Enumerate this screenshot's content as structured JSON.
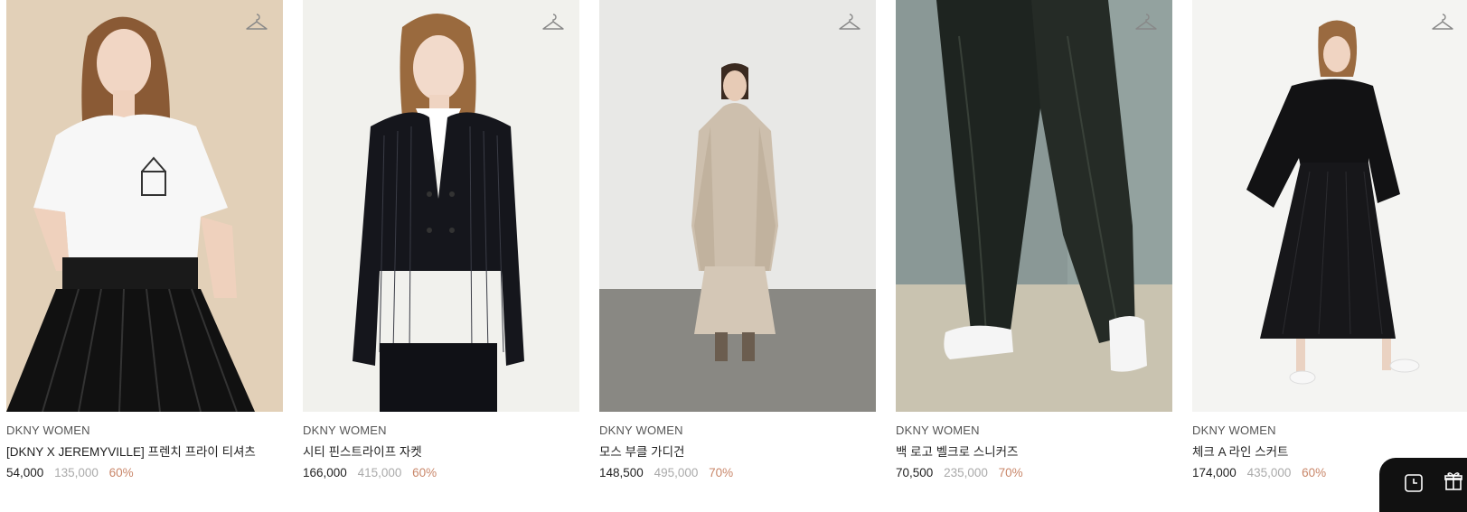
{
  "products": [
    {
      "brand": "DKNY WOMEN",
      "name": "[DKNY X JEREMYVILLE] 프렌치 프라이 티셔츠",
      "price": "54,000",
      "original_price": "135,000",
      "discount": "60%"
    },
    {
      "brand": "DKNY WOMEN",
      "name": "시티 핀스트라이프 자켓",
      "price": "166,000",
      "original_price": "415,000",
      "discount": "60%"
    },
    {
      "brand": "DKNY WOMEN",
      "name": "모스 부클 가디건",
      "price": "148,500",
      "original_price": "495,000",
      "discount": "70%"
    },
    {
      "brand": "DKNY WOMEN",
      "name": "백 로고 벨크로 스니커즈",
      "price": "70,500",
      "original_price": "235,000",
      "discount": "70%"
    },
    {
      "brand": "DKNY WOMEN",
      "name": "체크 A 라인 스커트",
      "price": "174,000",
      "original_price": "435,000",
      "discount": "60%"
    }
  ],
  "icons": {
    "wishlist": "hanger-icon",
    "recent": "clock-icon",
    "gift": "gift-icon"
  },
  "colors": {
    "discount": "#c9876a",
    "original_price": "#aaaaaa",
    "floating_bar": "#111111"
  }
}
